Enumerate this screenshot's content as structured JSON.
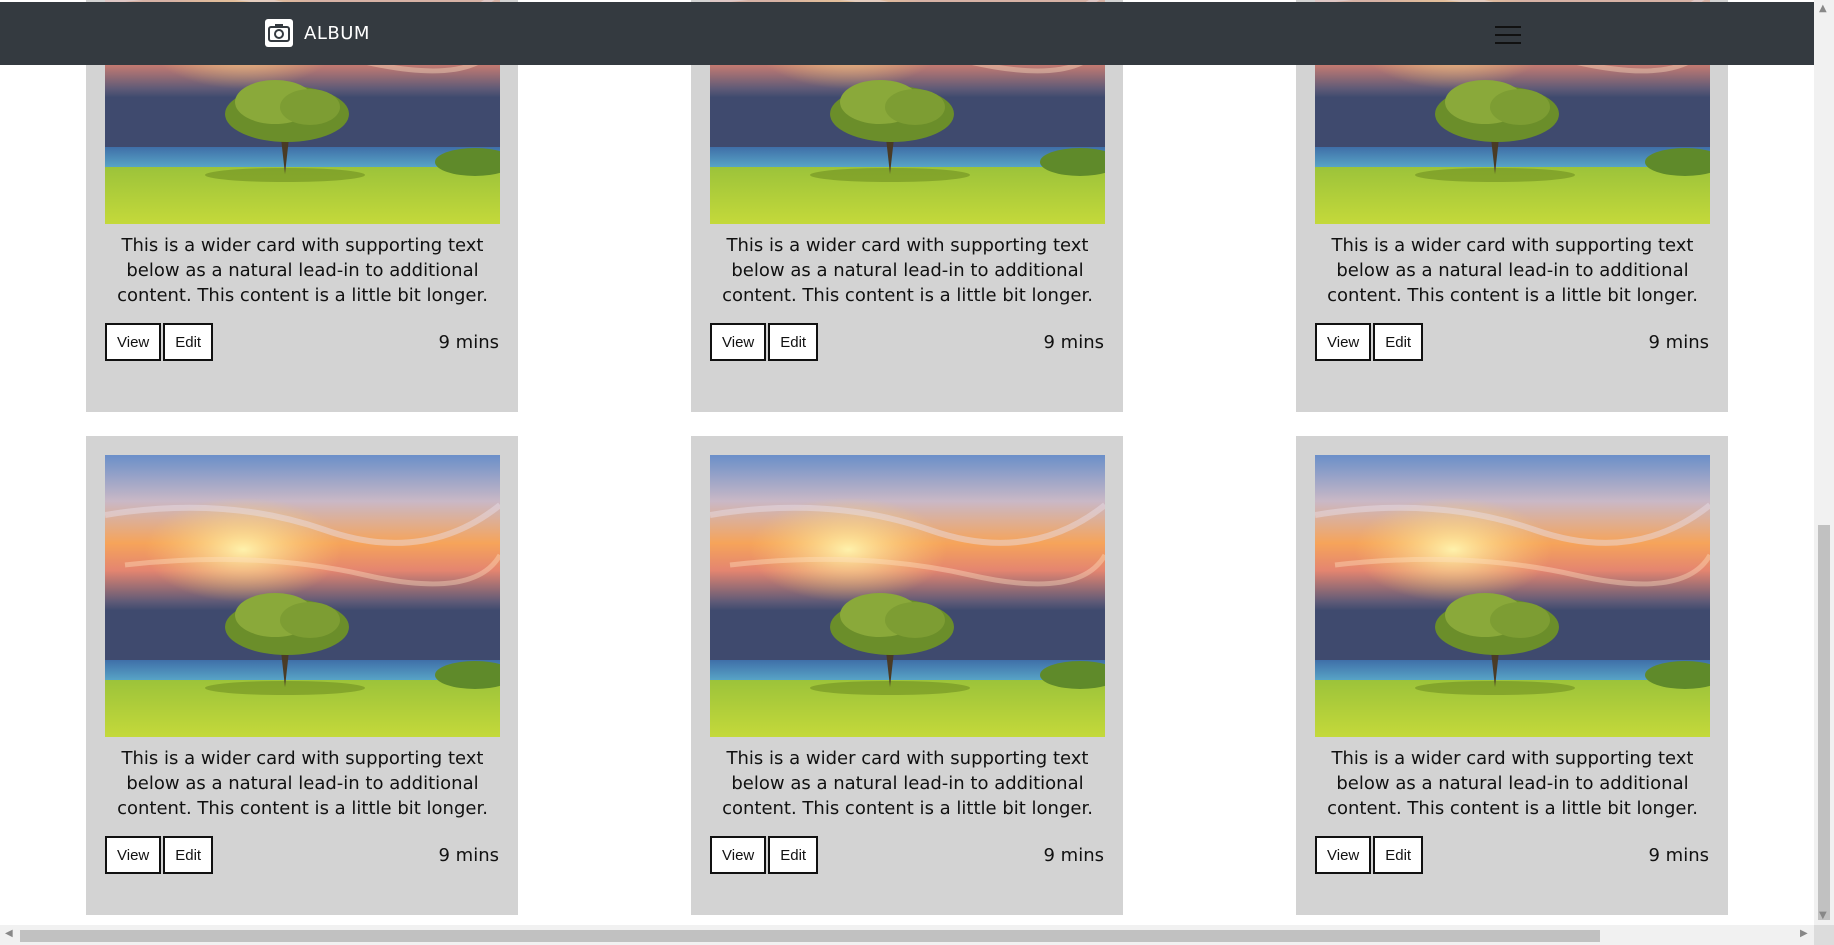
{
  "navbar": {
    "brand_icon": "camera-icon",
    "brand_text": "ALBUM",
    "toggler_icon": "hamburger-menu-icon"
  },
  "cards": [
    {
      "text": "This is a wider card with supporting text below as a natural lead-in to additional content. This content is a little bit longer.",
      "view_label": "View",
      "edit_label": "Edit",
      "time": "9 mins"
    },
    {
      "text": "This is a wider card with supporting text below as a natural lead-in to additional content. This content is a little bit longer.",
      "view_label": "View",
      "edit_label": "Edit",
      "time": "9 mins"
    },
    {
      "text": "This is a wider card with supporting text below as a natural lead-in to additional content. This content is a little bit longer.",
      "view_label": "View",
      "edit_label": "Edit",
      "time": "9 mins"
    },
    {
      "text": "This is a wider card with supporting text below as a natural lead-in to additional content. This content is a little bit longer.",
      "view_label": "View",
      "edit_label": "Edit",
      "time": "9 mins"
    },
    {
      "text": "This is a wider card with supporting text below as a natural lead-in to additional content. This content is a little bit longer.",
      "view_label": "View",
      "edit_label": "Edit",
      "time": "9 mins"
    },
    {
      "text": "This is a wider card with supporting text below as a natural lead-in to additional content. This content is a little bit longer.",
      "view_label": "View",
      "edit_label": "Edit",
      "time": "9 mins"
    }
  ],
  "colors": {
    "navbar_bg": "#343a40",
    "card_bg": "#d3d3d3"
  }
}
